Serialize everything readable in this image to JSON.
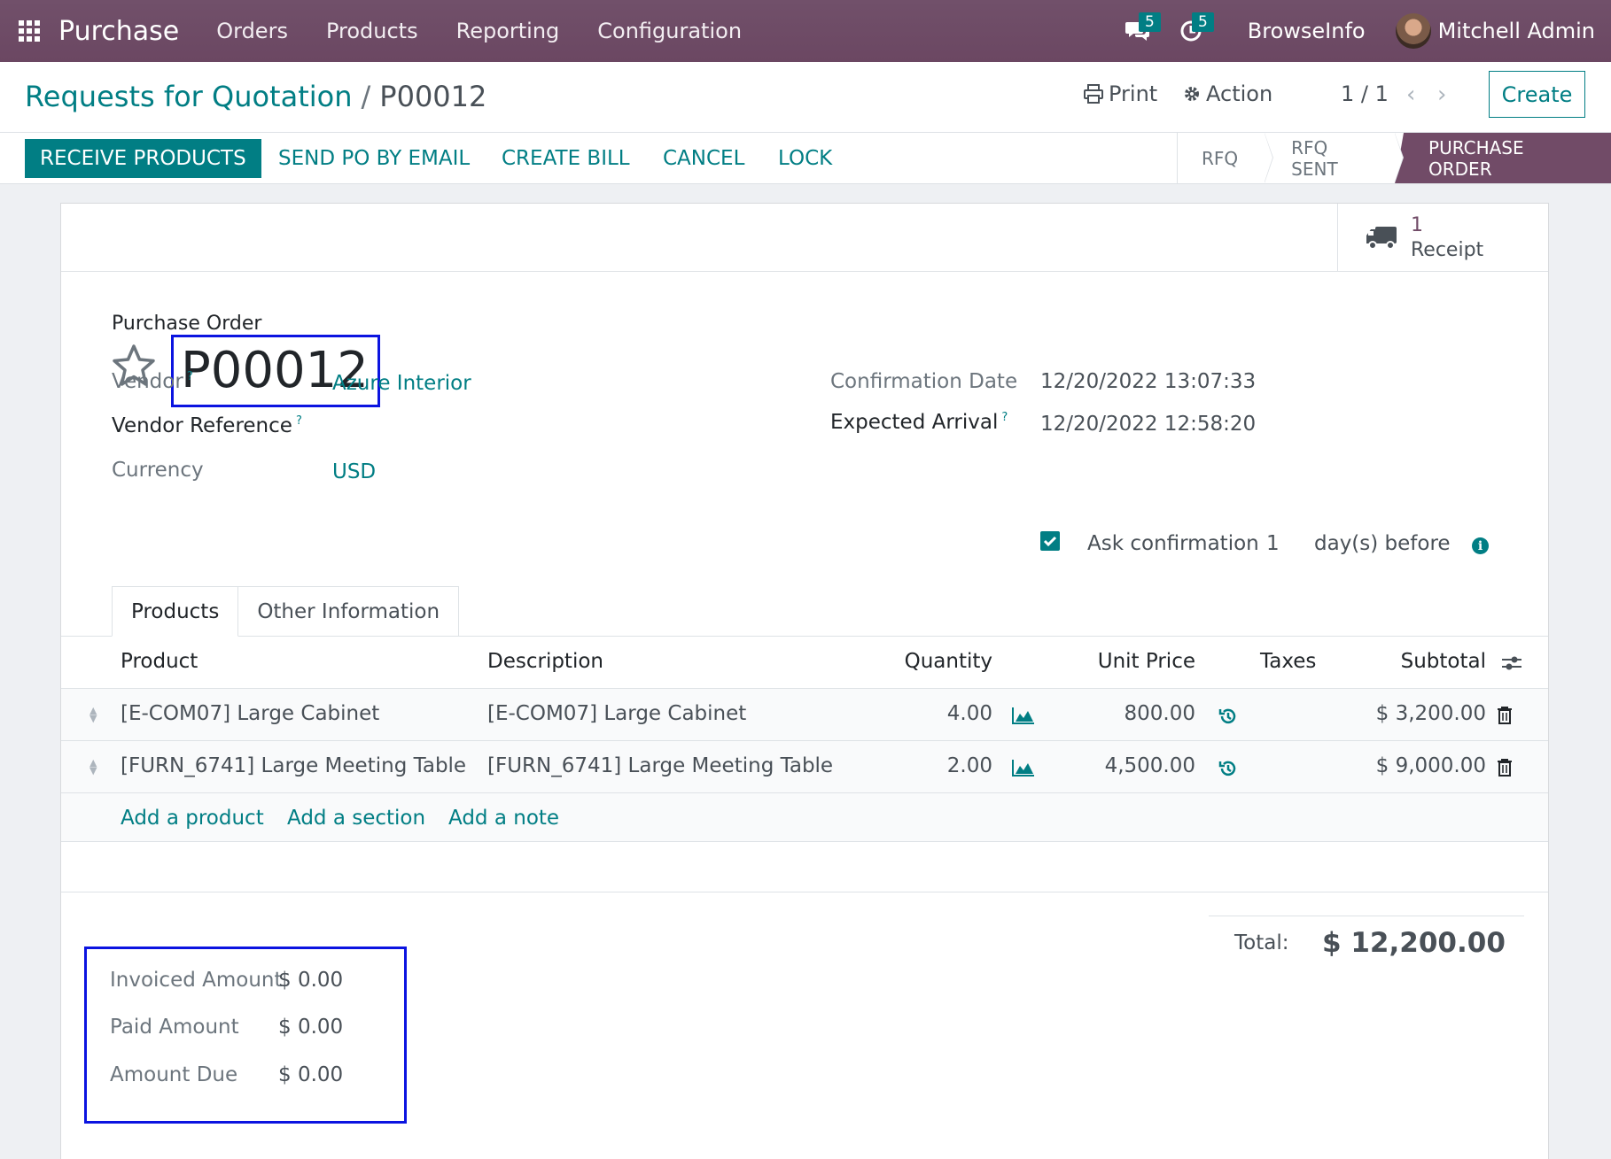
{
  "navbar": {
    "app_name": "Purchase",
    "menu": [
      "Orders",
      "Products",
      "Reporting",
      "Configuration"
    ],
    "messages_count": "5",
    "activities_count": "5",
    "company": "BrowseInfo",
    "user": "Mitchell Admin"
  },
  "control": {
    "breadcrumb_parent": "Requests for Quotation",
    "breadcrumb_sep": "/",
    "breadcrumb_current": "P00012",
    "print_label": "Print",
    "action_label": "Action",
    "pager": "1 / 1",
    "create_label": "Create"
  },
  "statusbar": {
    "buttons": [
      "RECEIVE PRODUCTS",
      "SEND PO BY EMAIL",
      "CREATE BILL",
      "CANCEL",
      "LOCK"
    ],
    "stages": [
      "RFQ",
      "RFQ SENT",
      "PURCHASE ORDER"
    ],
    "active_stage": "PURCHASE ORDER"
  },
  "smart_button": {
    "value": "1",
    "label": "Receipt"
  },
  "form": {
    "title_label": "Purchase Order",
    "name": "P00012",
    "vendor_label": "Vendor",
    "vendor": "Azure Interior",
    "vendor_ref_label": "Vendor Reference",
    "vendor_ref": "",
    "currency_label": "Currency",
    "currency": "USD",
    "confirmation_date_label": "Confirmation Date",
    "confirmation_date": "12/20/2022 13:07:33",
    "expected_arrival_label": "Expected Arrival",
    "expected_arrival": "12/20/2022 12:58:20",
    "ask_confirmation_label": "Ask confirmation",
    "ask_confirmation_days": "1",
    "ask_confirmation_suffix": "day(s) before",
    "help_mark": "?"
  },
  "tabs": [
    "Products",
    "Other Information"
  ],
  "table": {
    "headers": {
      "product": "Product",
      "description": "Description",
      "quantity": "Quantity",
      "unit_price": "Unit Price",
      "taxes": "Taxes",
      "subtotal": "Subtotal"
    },
    "rows": [
      {
        "product": "[E-COM07] Large Cabinet",
        "description": "[E-COM07] Large Cabinet",
        "quantity": "4.00",
        "unit_price": "800.00",
        "taxes": "",
        "subtotal": "$ 3,200.00"
      },
      {
        "product": "[FURN_6741] Large Meeting Table",
        "description": "[FURN_6741] Large Meeting Table",
        "quantity": "2.00",
        "unit_price": "4,500.00",
        "taxes": "",
        "subtotal": "$ 9,000.00"
      }
    ],
    "add_links": [
      "Add a product",
      "Add a section",
      "Add a note"
    ]
  },
  "totals": {
    "total_label": "Total:",
    "total_value": "$ 12,200.00",
    "invoiced_label": "Invoiced Amount",
    "invoiced_value": "$ 0.00",
    "paid_label": "Paid Amount",
    "paid_value": "$ 0.00",
    "due_label": "Amount Due",
    "due_value": "$ 0.00"
  },
  "colors": {
    "brand": "#714b67",
    "accent": "#017e84",
    "highlight_box": "#0b14e0"
  }
}
